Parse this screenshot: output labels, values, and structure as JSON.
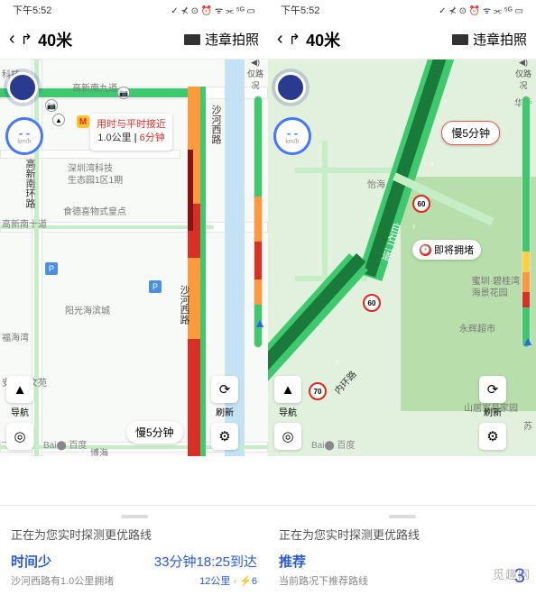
{
  "status": {
    "time": "下午5:52",
    "icons": "✓ ⊀ ⊙ ⏰ ᯤ ⫘ ⁵ᴳ ▭"
  },
  "nav": {
    "distance": "40米",
    "violation": "违章拍照"
  },
  "left": {
    "traffic_label": "仅路况",
    "speed_unit": "km/h",
    "route_info": {
      "line1": "用时与平时接近",
      "dist": "1.0公里",
      "time": "6分钟"
    },
    "slow_badge": "慢5分钟",
    "roads": {
      "gaoxin9": "高新南九道",
      "gaoxin10": "高新南十道",
      "shahexilu": "沙河西路",
      "gaoxinnanhuan": "高新南环路"
    },
    "pois": {
      "keji": "科技",
      "szwan": "深圳湾科技\n生态园1区1期",
      "shidexi": "食德喜物式皇点",
      "yangguang": "阳光海滨城",
      "fuhaiwan": "福海湾",
      "anjubo": "安居博文苑",
      "bohai": "博海",
      "yidao": "..道"
    },
    "sheet": {
      "title": "正在为您实时探测更优路线",
      "left_big": "时间少",
      "left_sub": "沙河西路有1.0公里拥堵",
      "right_big": "33分钟18:25到达",
      "right_sub": "12公里 · ⚡6"
    },
    "controls": {
      "nav": "导航",
      "refresh": "刷新",
      "baidu": "Bai⬤ 百度"
    }
  },
  "right": {
    "traffic_label": "仅路况",
    "speed_unit": "km/h",
    "slow_badge": "慢5分钟",
    "congestion": "即将拥堵",
    "roads": {
      "shenwan": "白石/深湾",
      "neihuanlu": "内环路"
    },
    "pois": {
      "huaqiao": "华侨",
      "yihai": "怡海",
      "biguiwan": "蜜圳·碧桂湾\n海景花园",
      "yonghui": "永辉超市",
      "shanju": "山居岁月家园",
      "su": "苏"
    },
    "speed_limits": [
      "60",
      "60",
      "70"
    ],
    "sheet": {
      "title": "正在为您实时探测更优路线",
      "left_big": "推荐",
      "left_sub": "当前路况下推荐路线",
      "right_big": "3"
    },
    "controls": {
      "nav": "导航",
      "refresh": "刷新",
      "baidu": "Bai⬤ 百度"
    }
  },
  "watermark": "觅趣网"
}
